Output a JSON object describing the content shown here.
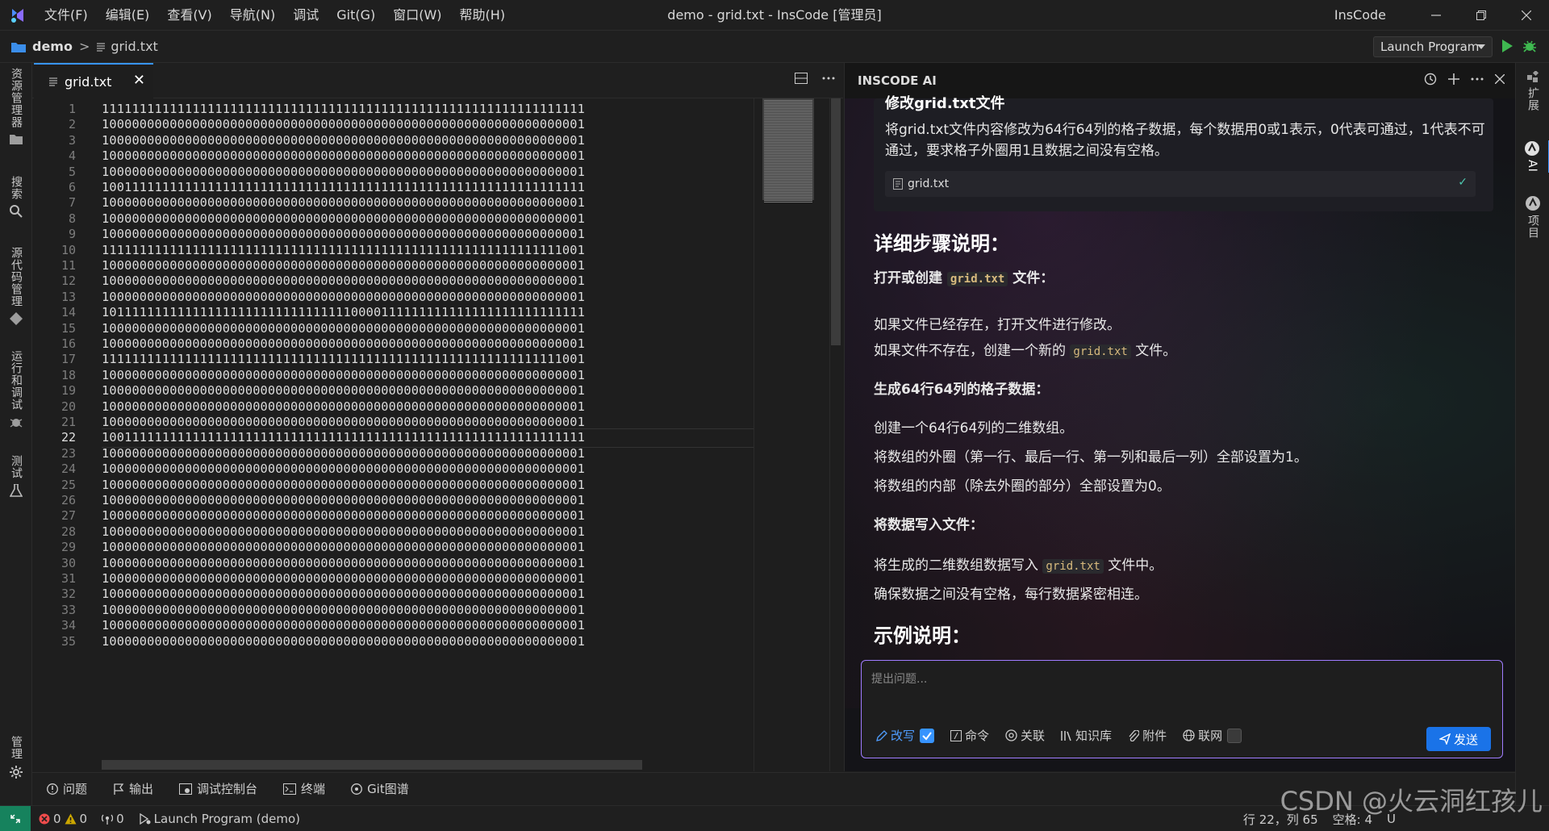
{
  "titlebar": {
    "menus": [
      "文件(F)",
      "编辑(E)",
      "查看(V)",
      "导航(N)",
      "调试",
      "Git(G)",
      "窗口(W)",
      "帮助(H)"
    ],
    "window_title": "demo - grid.txt - InsCode [管理员]",
    "brand": "InsCode"
  },
  "breadcrumb": {
    "folder": "demo",
    "separator": ">",
    "file": "grid.txt"
  },
  "run": {
    "config_label": "Launch Program"
  },
  "activity": {
    "explorer": "资源管理器",
    "search": "搜索",
    "scm": "源代码管理",
    "run_debug": "运行和调试",
    "test": "测试",
    "manage": "管理"
  },
  "editor": {
    "tab_label": "grid.txt",
    "tab_close": "✕",
    "current_line": 22,
    "line_numbers": [
      "1",
      "2",
      "3",
      "4",
      "5",
      "6",
      "7",
      "8",
      "9",
      "10",
      "11",
      "12",
      "13",
      "14",
      "15",
      "16",
      "17",
      "18",
      "19",
      "20",
      "21",
      "22",
      "23",
      "24",
      "25",
      "26",
      "27",
      "28",
      "29",
      "30",
      "31",
      "32",
      "33",
      "34",
      "35"
    ],
    "lines": [
      "1111111111111111111111111111111111111111111111111111111111111111",
      "1000000000000000000000000000000000000000000000000000000000000001",
      "1000000000000000000000000000000000000000000000000000000000000001",
      "1000000000000000000000000000000000000000000000000000000000000001",
      "1000000000000000000000000000000000000000000000000000000000000001",
      "1001111111111111111111111111111111111111111111111111111111111111",
      "1000000000000000000000000000000000000000000000000000000000000001",
      "1000000000000000000000000000000000000000000000000000000000000001",
      "1000000000000000000000000000000000000000000000000000000000000001",
      "1111111111111111111111111111111111111111111111111111111111111001",
      "1000000000000000000000000000000000000000000000000000000000000001",
      "1000000000000000000000000000000000000000000000000000000000000001",
      "1000000000000000000000000000000000000000000000000000000000000001",
      "1011111111111111111111111111111110000111111111111111111111111111",
      "1000000000000000000000000000000000000000000000000000000000000001",
      "1000000000000000000000000000000000000000000000000000000000000001",
      "1111111111111111111111111111111111111111111111111111111111111001",
      "1000000000000000000000000000000000000000000000000000000000000001",
      "1000000000000000000000000000000000000000000000000000000000000001",
      "1000000000000000000000000000000000000000000000000000000000000001",
      "1000000000000000000000000000000000000000000000000000000000000001",
      "1001111111111111111111111111111111111111111111111111111111111111",
      "1000000000000000000000000000000000000000000000000000000000000001",
      "1000000000000000000000000000000000000000000000000000000000000001",
      "1000000000000000000000000000000000000000000000000000000000000001",
      "1000000000000000000000000000000000000000000000000000000000000001",
      "1000000000000000000000000000000000000000000000000000000000000001",
      "1000000000000000000000000000000000000000000000000000000000000001",
      "1000000000000000000000000000000000000000000000000000000000000001",
      "1000000000000000000000000000000000000000000000000000000000000001",
      "1000000000000000000000000000000000000000000000000000000000000001",
      "1000000000000000000000000000000000000000000000000000000000000001",
      "1000000000000000000000000000000000000000000000000000000000000001",
      "1000000000000000000000000000000000000000000000000000000000000001",
      "1000000000000000000000000000000000000000000000000000000000000001"
    ]
  },
  "ai": {
    "header": "INSCODE AI",
    "card_title": "修改grid.txt文件",
    "card_text": "将grid.txt文件内容修改为64行64列的格子数据，每个数据用0或1表示，0代表可通过，1代表不可通过，要求格子外圈用1且数据之间没有空格。",
    "file_ref": "grid.txt",
    "h_steps": "详细步骤说明：",
    "step1_pre": "打开或创建",
    "step1_code": "grid.txt",
    "step1_post": "文件：",
    "step1_a": "如果文件已经存在，打开文件进行修改。",
    "step1_b_pre": "如果文件不存在，创建一个新的",
    "step1_b_code": "grid.txt",
    "step1_b_post": "文件。",
    "step2": "生成64行64列的格子数据：",
    "step2_a": "创建一个64行64列的二维数组。",
    "step2_b": "将数组的外圈（第一行、最后一行、第一列和最后一列）全部设置为1。",
    "step2_c": "将数组的内部（除去外圈的部分）全部设置为0。",
    "step3": "将数据写入文件：",
    "step3_a_pre": "将生成的二维数组数据写入",
    "step3_a_code": "grid.txt",
    "step3_a_post": "文件中。",
    "step3_b": "确保数据之间没有空格，每行数据紧密相连。",
    "h_example": "示例说明：",
    "input_placeholder": "提出问题...",
    "opt_rewrite": "改写",
    "opt_command": "命令",
    "opt_relate": "关联",
    "opt_kb": "知识库",
    "opt_attach": "附件",
    "opt_web": "联网",
    "send": "发送"
  },
  "rightbar": {
    "extensions": "扩展",
    "ai": "AI",
    "project": "项目"
  },
  "panel": {
    "problems": "问题",
    "output": "输出",
    "debug_console": "调试控制台",
    "terminal": "终端",
    "git_graph": "Git图谱"
  },
  "status": {
    "errors": "0",
    "warnings": "0",
    "ports": "0",
    "launch": "Launch Program (demo)",
    "position": "行 22，列 65",
    "spaces": "空格: 4",
    "encoding": "U"
  },
  "watermark": "CSDN @火云洞红孩儿",
  "colors": {
    "accent": "#3794ff",
    "run_green": "#89d185",
    "send_blue": "#1a73e8",
    "remote_green": "#16825d",
    "error_red": "#f14c4c",
    "warning_yellow": "#cca700"
  }
}
